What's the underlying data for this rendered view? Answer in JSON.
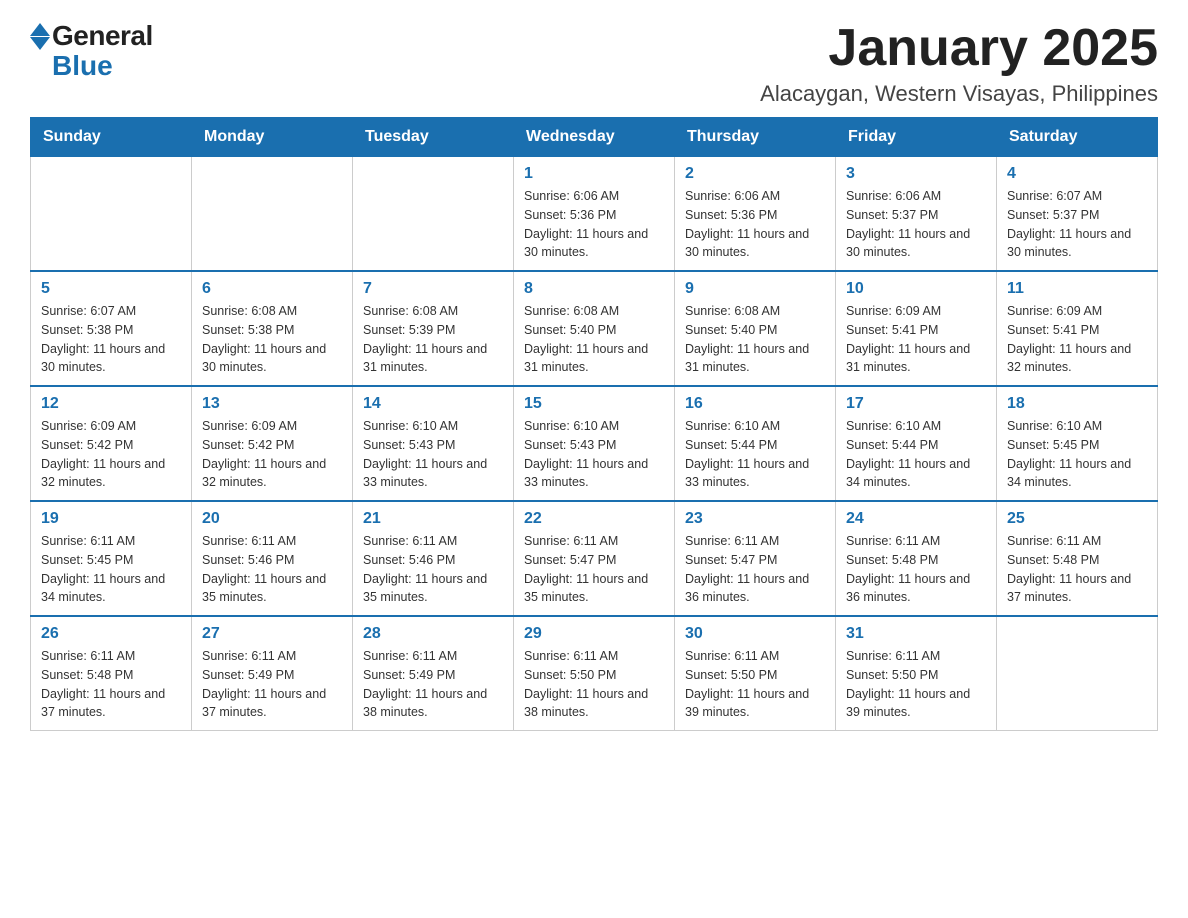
{
  "logo": {
    "text_general": "General",
    "text_blue": "Blue"
  },
  "title": "January 2025",
  "subtitle": "Alacaygan, Western Visayas, Philippines",
  "days_of_week": [
    "Sunday",
    "Monday",
    "Tuesday",
    "Wednesday",
    "Thursday",
    "Friday",
    "Saturday"
  ],
  "weeks": [
    [
      {
        "day": "",
        "info": ""
      },
      {
        "day": "",
        "info": ""
      },
      {
        "day": "",
        "info": ""
      },
      {
        "day": "1",
        "info": "Sunrise: 6:06 AM\nSunset: 5:36 PM\nDaylight: 11 hours and 30 minutes."
      },
      {
        "day": "2",
        "info": "Sunrise: 6:06 AM\nSunset: 5:36 PM\nDaylight: 11 hours and 30 minutes."
      },
      {
        "day": "3",
        "info": "Sunrise: 6:06 AM\nSunset: 5:37 PM\nDaylight: 11 hours and 30 minutes."
      },
      {
        "day": "4",
        "info": "Sunrise: 6:07 AM\nSunset: 5:37 PM\nDaylight: 11 hours and 30 minutes."
      }
    ],
    [
      {
        "day": "5",
        "info": "Sunrise: 6:07 AM\nSunset: 5:38 PM\nDaylight: 11 hours and 30 minutes."
      },
      {
        "day": "6",
        "info": "Sunrise: 6:08 AM\nSunset: 5:38 PM\nDaylight: 11 hours and 30 minutes."
      },
      {
        "day": "7",
        "info": "Sunrise: 6:08 AM\nSunset: 5:39 PM\nDaylight: 11 hours and 31 minutes."
      },
      {
        "day": "8",
        "info": "Sunrise: 6:08 AM\nSunset: 5:40 PM\nDaylight: 11 hours and 31 minutes."
      },
      {
        "day": "9",
        "info": "Sunrise: 6:08 AM\nSunset: 5:40 PM\nDaylight: 11 hours and 31 minutes."
      },
      {
        "day": "10",
        "info": "Sunrise: 6:09 AM\nSunset: 5:41 PM\nDaylight: 11 hours and 31 minutes."
      },
      {
        "day": "11",
        "info": "Sunrise: 6:09 AM\nSunset: 5:41 PM\nDaylight: 11 hours and 32 minutes."
      }
    ],
    [
      {
        "day": "12",
        "info": "Sunrise: 6:09 AM\nSunset: 5:42 PM\nDaylight: 11 hours and 32 minutes."
      },
      {
        "day": "13",
        "info": "Sunrise: 6:09 AM\nSunset: 5:42 PM\nDaylight: 11 hours and 32 minutes."
      },
      {
        "day": "14",
        "info": "Sunrise: 6:10 AM\nSunset: 5:43 PM\nDaylight: 11 hours and 33 minutes."
      },
      {
        "day": "15",
        "info": "Sunrise: 6:10 AM\nSunset: 5:43 PM\nDaylight: 11 hours and 33 minutes."
      },
      {
        "day": "16",
        "info": "Sunrise: 6:10 AM\nSunset: 5:44 PM\nDaylight: 11 hours and 33 minutes."
      },
      {
        "day": "17",
        "info": "Sunrise: 6:10 AM\nSunset: 5:44 PM\nDaylight: 11 hours and 34 minutes."
      },
      {
        "day": "18",
        "info": "Sunrise: 6:10 AM\nSunset: 5:45 PM\nDaylight: 11 hours and 34 minutes."
      }
    ],
    [
      {
        "day": "19",
        "info": "Sunrise: 6:11 AM\nSunset: 5:45 PM\nDaylight: 11 hours and 34 minutes."
      },
      {
        "day": "20",
        "info": "Sunrise: 6:11 AM\nSunset: 5:46 PM\nDaylight: 11 hours and 35 minutes."
      },
      {
        "day": "21",
        "info": "Sunrise: 6:11 AM\nSunset: 5:46 PM\nDaylight: 11 hours and 35 minutes."
      },
      {
        "day": "22",
        "info": "Sunrise: 6:11 AM\nSunset: 5:47 PM\nDaylight: 11 hours and 35 minutes."
      },
      {
        "day": "23",
        "info": "Sunrise: 6:11 AM\nSunset: 5:47 PM\nDaylight: 11 hours and 36 minutes."
      },
      {
        "day": "24",
        "info": "Sunrise: 6:11 AM\nSunset: 5:48 PM\nDaylight: 11 hours and 36 minutes."
      },
      {
        "day": "25",
        "info": "Sunrise: 6:11 AM\nSunset: 5:48 PM\nDaylight: 11 hours and 37 minutes."
      }
    ],
    [
      {
        "day": "26",
        "info": "Sunrise: 6:11 AM\nSunset: 5:48 PM\nDaylight: 11 hours and 37 minutes."
      },
      {
        "day": "27",
        "info": "Sunrise: 6:11 AM\nSunset: 5:49 PM\nDaylight: 11 hours and 37 minutes."
      },
      {
        "day": "28",
        "info": "Sunrise: 6:11 AM\nSunset: 5:49 PM\nDaylight: 11 hours and 38 minutes."
      },
      {
        "day": "29",
        "info": "Sunrise: 6:11 AM\nSunset: 5:50 PM\nDaylight: 11 hours and 38 minutes."
      },
      {
        "day": "30",
        "info": "Sunrise: 6:11 AM\nSunset: 5:50 PM\nDaylight: 11 hours and 39 minutes."
      },
      {
        "day": "31",
        "info": "Sunrise: 6:11 AM\nSunset: 5:50 PM\nDaylight: 11 hours and 39 minutes."
      },
      {
        "day": "",
        "info": ""
      }
    ]
  ]
}
